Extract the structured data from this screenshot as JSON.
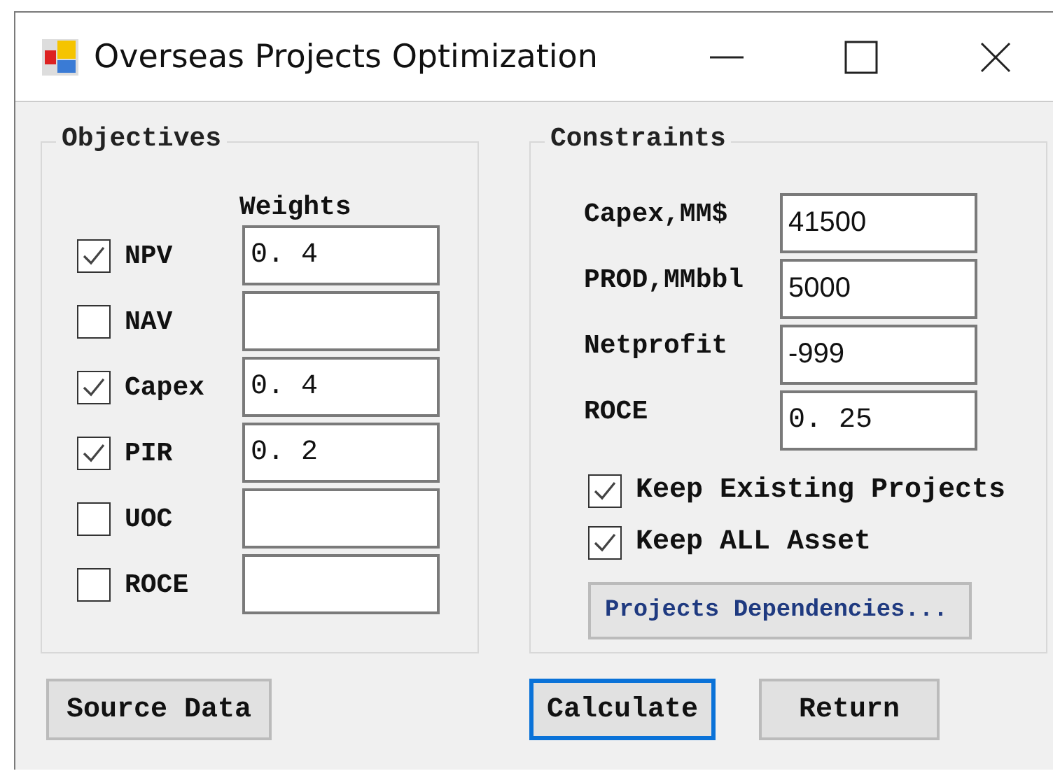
{
  "window": {
    "title": "Overseas Projects Optimization"
  },
  "objectives": {
    "title": "Objectives",
    "weights_label": "Weights",
    "items": [
      {
        "label": "NPV",
        "checked": true,
        "weight": "0. 4"
      },
      {
        "label": "NAV",
        "checked": false
      },
      {
        "label": "Capex",
        "checked": true,
        "weight": "0. 4"
      },
      {
        "label": "PIR",
        "checked": true,
        "weight": "0. 2"
      },
      {
        "label": "UOC",
        "checked": false
      },
      {
        "label": "ROCE",
        "checked": false
      }
    ]
  },
  "constraints": {
    "title": "Constraints",
    "fields": [
      {
        "label": "Capex,MM$",
        "value": "41500"
      },
      {
        "label": "PROD,MMbbl",
        "value": "5000"
      },
      {
        "label": "Netprofit",
        "value": "-999"
      },
      {
        "label": "ROCE",
        "value": "0. 25"
      }
    ],
    "options": [
      {
        "label": "Keep Existing Projects",
        "checked": true
      },
      {
        "label": "Keep ALL Asset",
        "checked": true
      }
    ],
    "dependencies_button": "Projects Dependencies..."
  },
  "buttons": [
    {
      "label": "Source Data",
      "focused": false
    },
    {
      "label": "Calculate",
      "focused": true
    },
    {
      "label": "Return",
      "focused": false
    }
  ]
}
